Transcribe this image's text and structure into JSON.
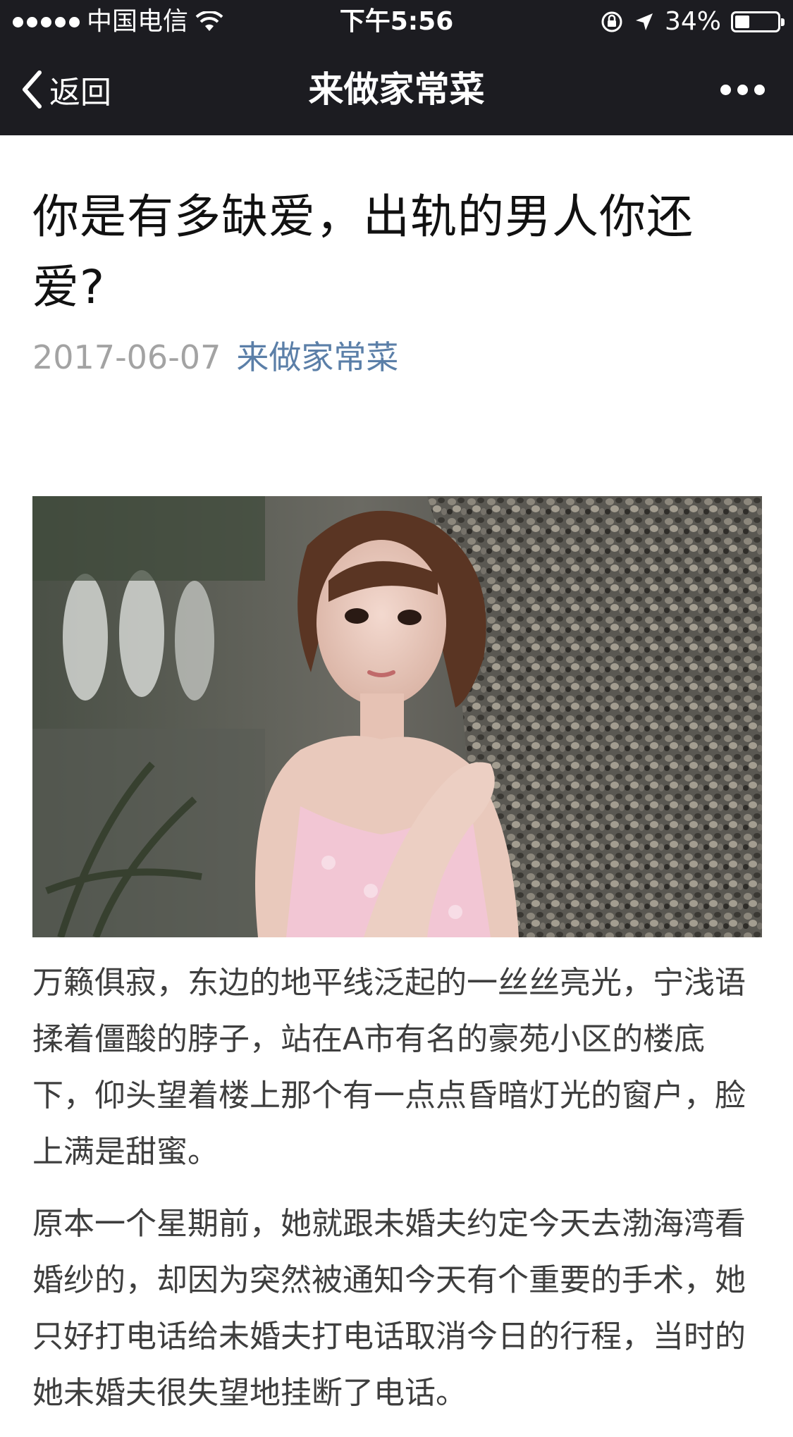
{
  "status_bar": {
    "carrier": "中国电信",
    "time": "下午5:56",
    "battery": "34%",
    "battery_level": 0.34
  },
  "nav": {
    "back_label": "返回",
    "title": "来做家常菜"
  },
  "article": {
    "title": "你是有多缺爱，出轨的男人你还爱?",
    "date": "2017-06-07",
    "author": "来做家常菜",
    "paragraphs": [
      "万籁俱寂，东边的地平线泛起的一丝丝亮光，宁浅语揉着僵酸的脖子，站在A市有名的豪苑小区的楼底下，仰头望着楼上那个有一点点昏暗灯光的窗户，脸上满是甜蜜。",
      "原本一个星期前，她就跟未婚夫约定今天去渤海湾看婚纱的，却因为突然被通知今天有个重要的手术，她只好打电话给未婚夫打电话取消今日的行程，当时的她未婚夫很失望地挂断了电话。"
    ]
  },
  "icons": {
    "back": "chevron-left-icon",
    "more": "more-dots-icon",
    "wifi": "wifi-icon",
    "lock": "orientation-lock-icon",
    "location": "location-arrow-icon",
    "battery": "battery-icon",
    "signal": "signal-dots-icon"
  },
  "colors": {
    "bar_bg": "#1c1c21",
    "author_link": "#5b7fa8",
    "date_gray": "#a3a3a3",
    "body_text": "#3e3e3e"
  }
}
